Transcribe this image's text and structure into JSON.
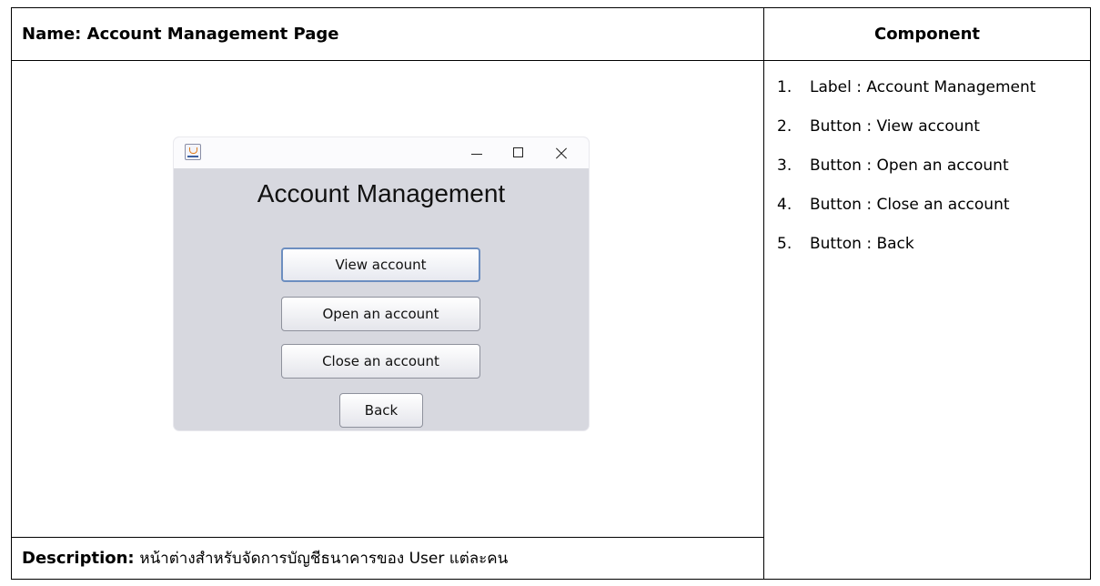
{
  "header": {
    "name": "Name: Account Management Page",
    "component": "Component"
  },
  "description": {
    "label": "Description:",
    "text": "หน้าต่างสำหรับจัดการบัญชีธนาคารของ User แต่ละคน"
  },
  "components": [
    {
      "num": "1.",
      "text": "Label : Account Management"
    },
    {
      "num": "2.",
      "text": "Button : View account"
    },
    {
      "num": "3.",
      "text": "Button : Open an account"
    },
    {
      "num": "4.",
      "text": "Button : Close an account"
    },
    {
      "num": "5.",
      "text": "Button : Back"
    }
  ],
  "window": {
    "title": "Account Management",
    "buttons": {
      "view": "View account",
      "open": "Open an account",
      "close": "Close an account",
      "back": "Back"
    },
    "icons": [
      "java-app-icon",
      "minimize-icon",
      "maximize-icon",
      "close-icon"
    ]
  }
}
